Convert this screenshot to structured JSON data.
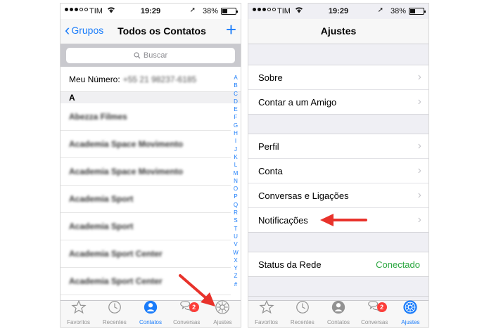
{
  "status_bar": {
    "carrier": "TIM",
    "time": "19:29",
    "battery": "38%",
    "battery_level": 0.38
  },
  "left_screen": {
    "nav": {
      "back_label": "Grupos",
      "title": "Todos os Contatos",
      "add": "+"
    },
    "search_placeholder": "Buscar",
    "my_number_label": "Meu Número:",
    "my_number_value": "+55 21 98237-6185",
    "section": "A",
    "contacts": [
      "Abezza Filmes",
      "Academia Space Movimento",
      "Academia Space Movimento",
      "Academia Sport",
      "Academia Sport",
      "Academia Sport Center",
      "Academia Sport Center"
    ],
    "index_letters": [
      "A",
      "B",
      "C",
      "D",
      "E",
      "F",
      "G",
      "H",
      "I",
      "J",
      "K",
      "L",
      "M",
      "N",
      "O",
      "P",
      "Q",
      "R",
      "S",
      "T",
      "U",
      "V",
      "W",
      "X",
      "Y",
      "Z",
      "#"
    ],
    "tabs": [
      {
        "label": "Favoritos",
        "icon": "star-icon"
      },
      {
        "label": "Recentes",
        "icon": "clock-icon"
      },
      {
        "label": "Contatos",
        "icon": "contacts-icon",
        "active": true
      },
      {
        "label": "Conversas",
        "icon": "chat-icon",
        "badge": "2"
      },
      {
        "label": "Ajustes",
        "icon": "gear-icon"
      }
    ]
  },
  "right_screen": {
    "nav": {
      "title": "Ajustes"
    },
    "groups": [
      [
        "Sobre",
        "Contar a um Amigo"
      ],
      [
        "Perfil",
        "Conta",
        "Conversas e Ligações",
        "Notificações"
      ]
    ],
    "status_row": {
      "label": "Status da Rede",
      "value": "Conectado"
    },
    "tabs": [
      {
        "label": "Favoritos",
        "icon": "star-icon"
      },
      {
        "label": "Recentes",
        "icon": "clock-icon"
      },
      {
        "label": "Contatos",
        "icon": "contacts-icon"
      },
      {
        "label": "Conversas",
        "icon": "chat-icon",
        "badge": "2"
      },
      {
        "label": "Ajustes",
        "icon": "gear-icon",
        "active": true
      }
    ]
  },
  "colors": {
    "accent": "#1a7cfa",
    "status_green": "#2aa73f",
    "badge_red": "#fc3d39",
    "annotation_arrow": "#e8322b"
  }
}
